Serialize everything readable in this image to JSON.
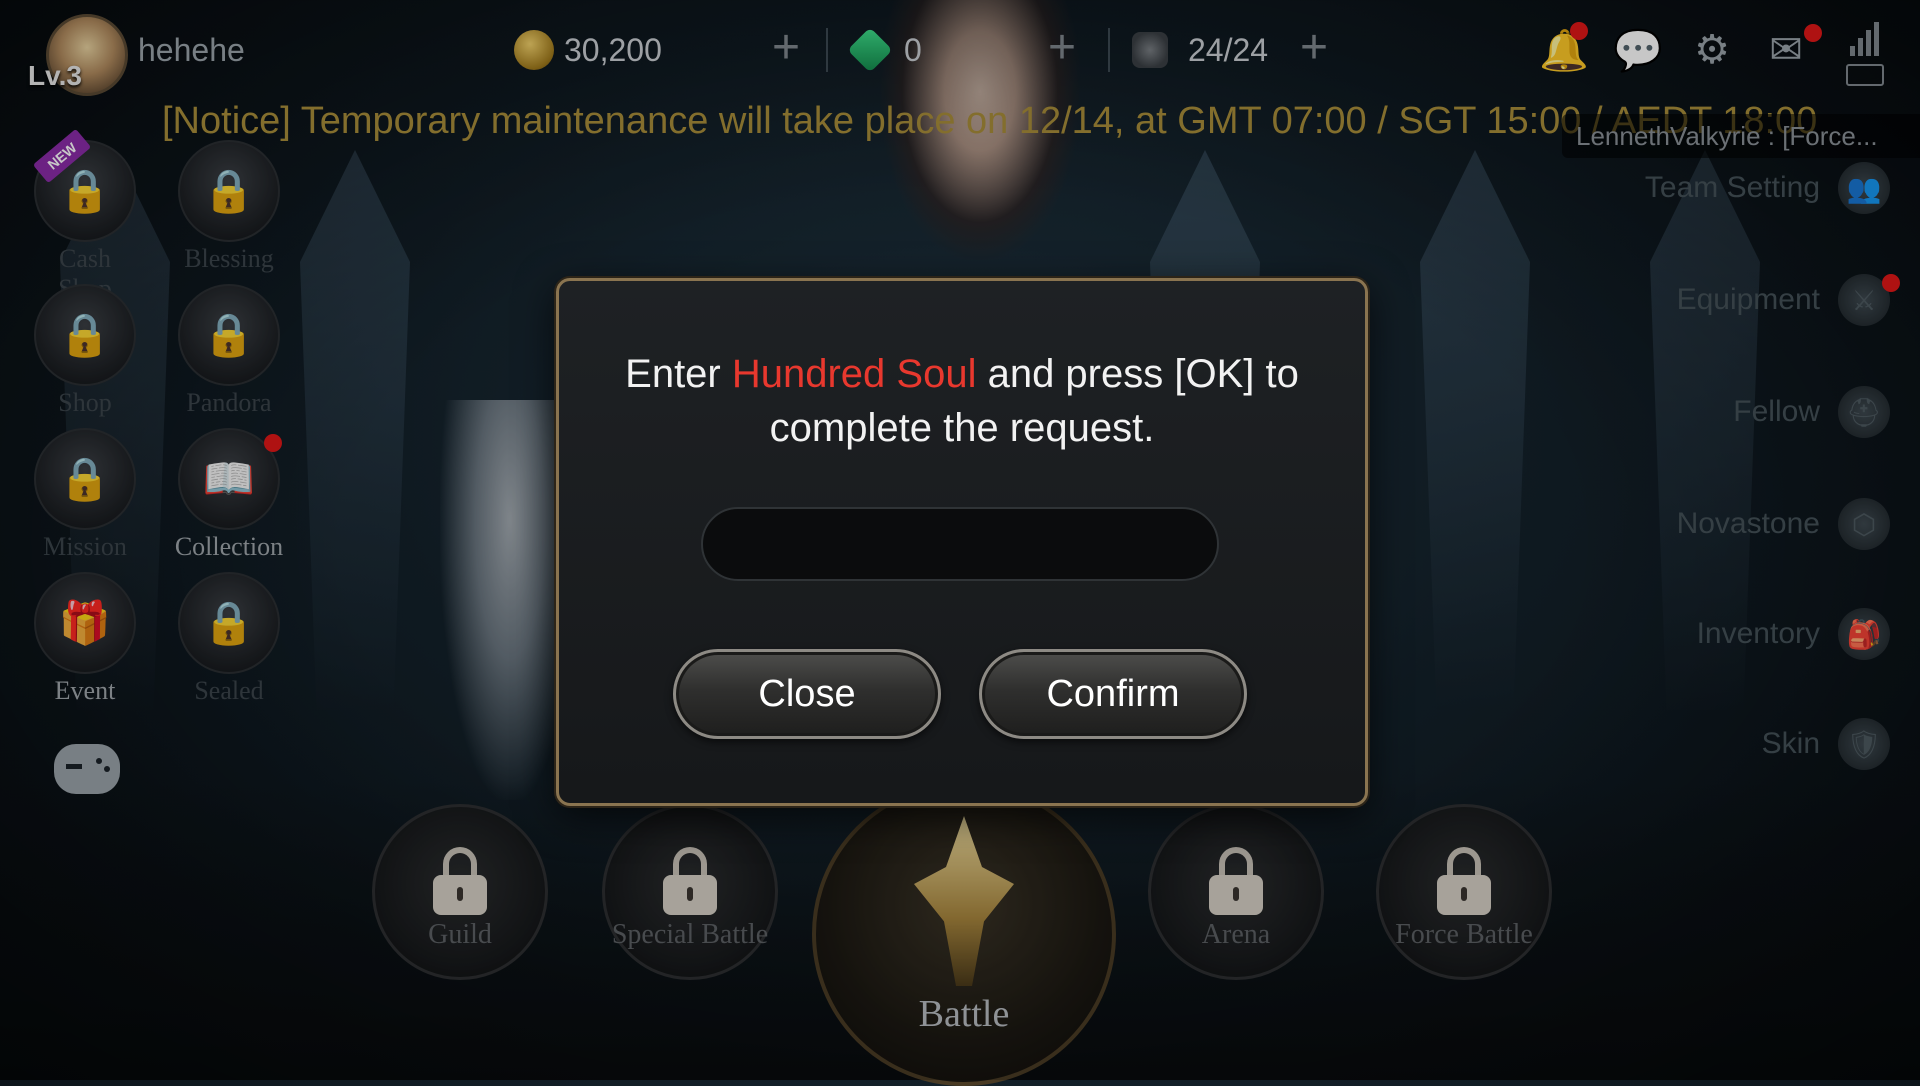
{
  "player": {
    "level": "Lv.3",
    "name": "hehehe"
  },
  "currencies": {
    "gold": "30,200",
    "gems": "0",
    "stamina": "24/24"
  },
  "notice": "[Notice] Temporary maintenance will take place on 12/14, at GMT 07:00 / SGT 15:00 / AEDT 18:00",
  "chat_preview": "LennethValkyrie : [Force...",
  "left_menu": [
    {
      "label": "Cash Shop",
      "icon": "lock-icon",
      "new": true,
      "badge": "NEW"
    },
    {
      "label": "Blessing",
      "icon": "lock-icon"
    },
    {
      "label": "Shop",
      "icon": "lock-icon"
    },
    {
      "label": "Pandora",
      "icon": "lock-icon"
    },
    {
      "label": "Mission",
      "icon": "lock-icon"
    },
    {
      "label": "Collection",
      "icon": "book-icon",
      "alert": true
    },
    {
      "label": "Event",
      "icon": "gift-icon"
    },
    {
      "label": "Sealed",
      "icon": "lock-icon"
    }
  ],
  "right_menu": [
    {
      "label": "Team Setting",
      "icon": "team-icon"
    },
    {
      "label": "Equipment",
      "icon": "swords-icon",
      "alert": true
    },
    {
      "label": "Fellow",
      "icon": "helmet-icon"
    },
    {
      "label": "Novastone",
      "icon": "hexagon-icon"
    },
    {
      "label": "Inventory",
      "icon": "bag-icon"
    },
    {
      "label": "Skin",
      "icon": "armor-icon"
    }
  ],
  "bottom_menu": [
    {
      "label": "Guild"
    },
    {
      "label": "Special Battle"
    },
    {
      "label": "Arena"
    },
    {
      "label": "Force Battle"
    }
  ],
  "battle_label": "Battle",
  "dialog": {
    "message_pre": "Enter ",
    "message_highlight": "Hundred Soul",
    "message_post": " and press [OK] to complete the request.",
    "input_value": "",
    "close_label": "Close",
    "confirm_label": "Confirm"
  },
  "colors": {
    "highlight_red": "#e8382e",
    "notice_gold": "#a88e3a",
    "alert_dot": "#e01818"
  }
}
